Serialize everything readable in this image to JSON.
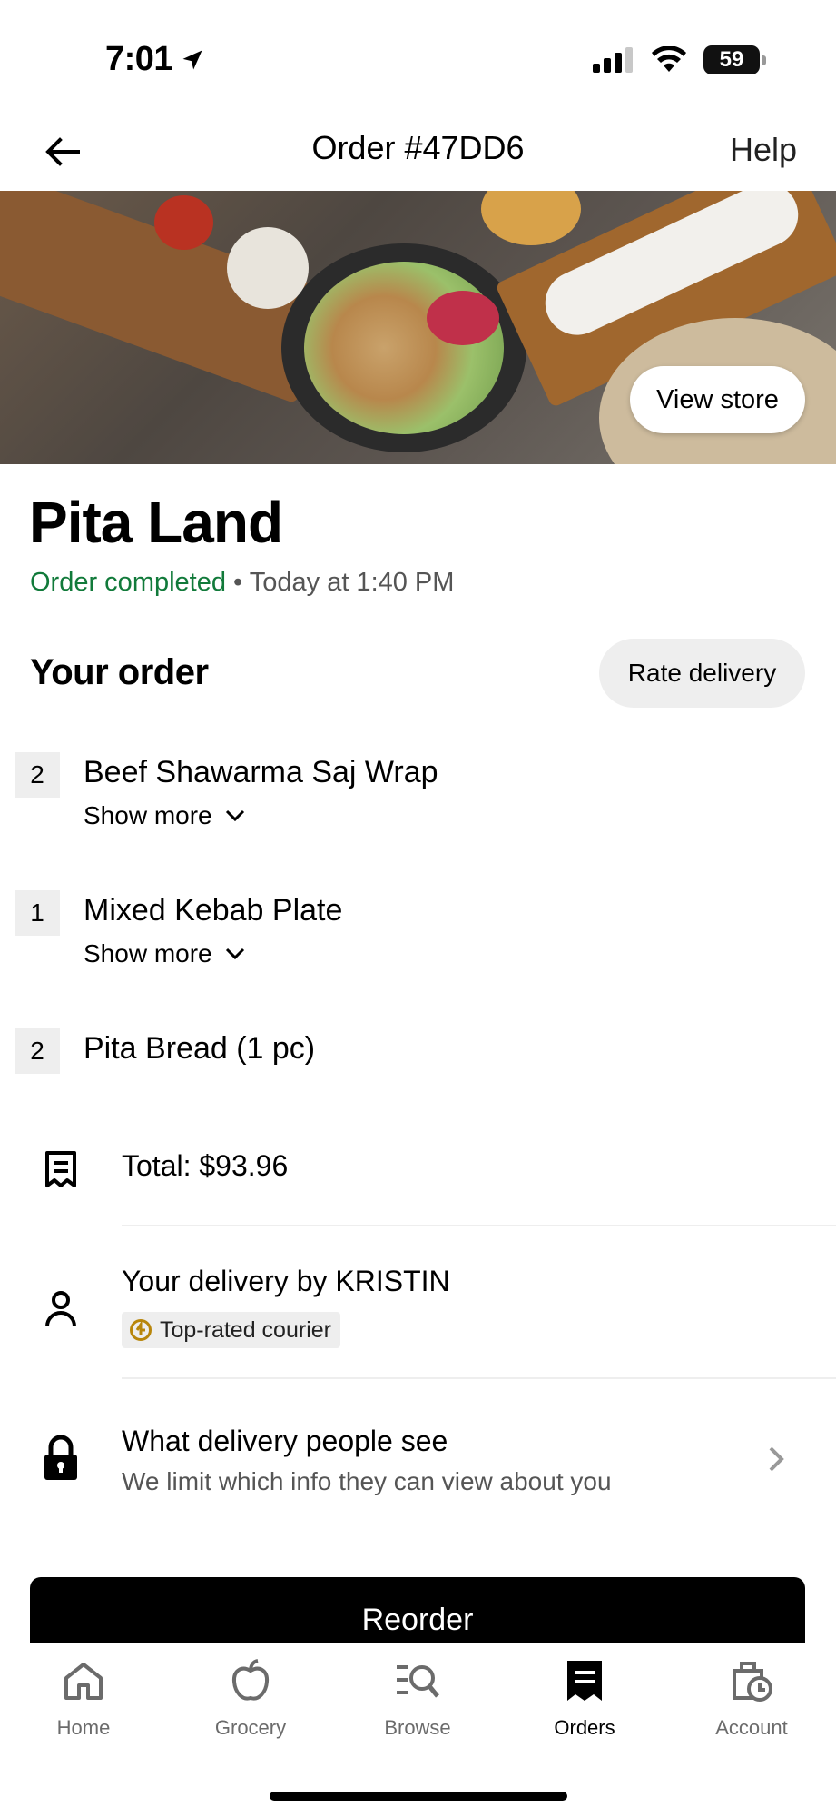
{
  "status_bar": {
    "time": "7:01",
    "battery": "59"
  },
  "header": {
    "title": "Order #47DD6",
    "help_label": "Help"
  },
  "hero": {
    "view_store_label": "View store"
  },
  "store": {
    "name": "Pita Land",
    "status": "Order completed",
    "separator": " • ",
    "completed_time": "Today at 1:40 PM"
  },
  "order": {
    "title": "Your order",
    "rate_label": "Rate delivery",
    "items": [
      {
        "qty": "2",
        "name": "Beef Shawarma Saj Wrap",
        "show_more": "Show more"
      },
      {
        "qty": "1",
        "name": "Mixed Kebab Plate",
        "show_more": "Show more"
      },
      {
        "qty": "2",
        "name": "Pita Bread (1 pc)"
      }
    ]
  },
  "total": {
    "label": "Total: $93.96"
  },
  "courier": {
    "label": "Your delivery by KRISTIN",
    "badge": "Top-rated courier"
  },
  "privacy": {
    "title": "What delivery people see",
    "subtitle": "We limit which info they can view about you"
  },
  "reorder_label": "Reorder",
  "tabs": [
    {
      "label": "Home",
      "icon": "home-icon"
    },
    {
      "label": "Grocery",
      "icon": "apple-icon"
    },
    {
      "label": "Browse",
      "icon": "browse-icon"
    },
    {
      "label": "Orders",
      "icon": "receipt-icon",
      "active": true
    },
    {
      "label": "Account",
      "icon": "account-icon"
    }
  ],
  "colors": {
    "accent_green": "#117a3a",
    "badge_gold": "#b8860b"
  }
}
